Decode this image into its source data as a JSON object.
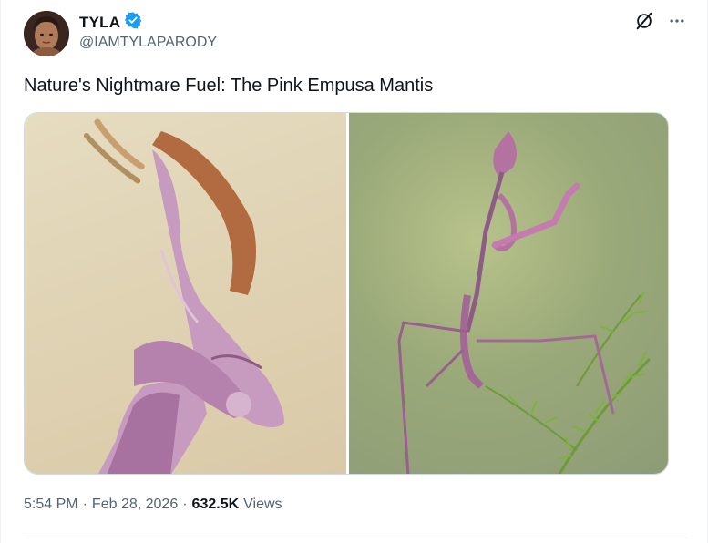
{
  "tweet": {
    "author_name": "TYLA",
    "author_handle": "@IAMTYLAPARODY",
    "verified": true,
    "text": "Nature's Nightmare Fuel: The Pink Empusa Mantis",
    "time": "5:54 PM",
    "date": "Feb 28, 2026",
    "views_count": "632.5K",
    "views_label": "Views",
    "separator": "·"
  },
  "icons": {
    "verified": "verified-badge-icon",
    "grok": "grok-icon",
    "more": "more-icon"
  },
  "colors": {
    "verified_blue": "#1d9bf0",
    "secondary_text": "#536471",
    "primary_text": "#0f1419"
  }
}
